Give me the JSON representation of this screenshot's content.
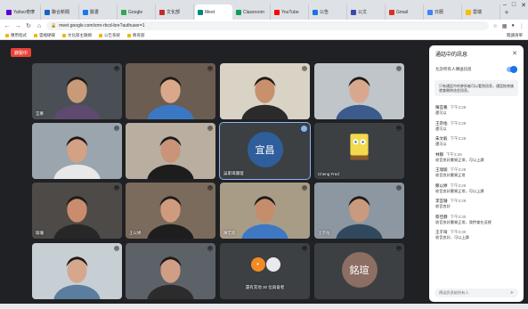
{
  "tabs": [
    {
      "label": "Yahoo奇摩",
      "color": "#6001d2"
    },
    {
      "label": "聯合新聞",
      "color": "#1565c0"
    },
    {
      "label": "臉書",
      "color": "#1877f2"
    },
    {
      "label": "Google",
      "color": "#34a853"
    },
    {
      "label": "文化部",
      "color": "#c62828"
    },
    {
      "label": "Meet",
      "color": "#00897b",
      "active": true
    },
    {
      "label": "Classroom",
      "color": "#0f9d58"
    },
    {
      "label": "YouTube",
      "color": "#ff0000"
    },
    {
      "label": "公告",
      "color": "#1a73e8"
    },
    {
      "label": "公文",
      "color": "#3949ab"
    },
    {
      "label": "Gmail",
      "color": "#d93025"
    },
    {
      "label": "日曆",
      "color": "#4285f4"
    },
    {
      "label": "雲端",
      "color": "#fbbc04"
    }
  ],
  "address": {
    "url": "meet.google.com/xmr-rbcd-bre?authuser=1"
  },
  "bookmarks": [
    "應用程式",
    "雲端硬碟",
    "文化部主題網",
    "公告系統",
    "教育部"
  ],
  "bookmarks_right": "閱讀清單",
  "live_badge": "錄製中",
  "tiles": [
    {
      "name": "宜蓁",
      "kind": "person",
      "bg": "#4a4f55",
      "skin": "#c99a7a",
      "shirt": "#5e4a6e"
    },
    {
      "name": "",
      "kind": "person",
      "bg": "#6b5d52",
      "skin": "#d9a88a",
      "shirt": "#3b78c4"
    },
    {
      "name": "",
      "kind": "person",
      "bg": "#d9d3c5",
      "skin": "#c8906c",
      "shirt": "#2b2b2b"
    },
    {
      "name": "",
      "kind": "person",
      "bg": "#bfc5c8",
      "skin": "#d8a88e",
      "shirt": "#3a5b8c"
    },
    {
      "name": "",
      "kind": "person",
      "bg": "#9aa5ad",
      "skin": "#d4a184",
      "shirt": "#e8e8e8"
    },
    {
      "name": "",
      "kind": "person",
      "bg": "#b9aea0",
      "skin": "#c99478",
      "shirt": "#1d1d1d"
    },
    {
      "name": "吳家瑋護理",
      "kind": "avatar",
      "initial": "宜昌",
      "avatar_color": "#2e5e9c"
    },
    {
      "name": "Cheng Fred",
      "kind": "sponge"
    },
    {
      "name": "瑜珊",
      "kind": "person",
      "bg": "#4e4a47",
      "skin": "#c98d6e",
      "shirt": "#272727"
    },
    {
      "name": "王以婷",
      "kind": "person",
      "bg": "#7a6b5c",
      "skin": "#cf9b7e",
      "shirt": "#1e1e1e"
    },
    {
      "name": "陳宏銘",
      "kind": "person",
      "bg": "#a89c86",
      "skin": "#c48e6c",
      "shirt": "#3f78c2"
    },
    {
      "name": "王宗佑",
      "kind": "person",
      "bg": "#8d97a1",
      "skin": "#c99a7e",
      "shirt": "#31495e"
    },
    {
      "name": "",
      "kind": "person",
      "bg": "#c8cfd4",
      "skin": "#d5a78c",
      "shirt": "#5b7e9e"
    },
    {
      "name": "",
      "kind": "person",
      "bg": "#5d6168",
      "skin": "#cf9e84",
      "shirt": "#2c2c2c"
    },
    {
      "name": "還有其他 30 位與會者",
      "kind": "more",
      "c1": "#f28b24",
      "c2": "#e8eaed"
    },
    {
      "name": "",
      "kind": "avatar",
      "initial": "銘瑄",
      "avatar_color": "#8d6e63"
    }
  ],
  "chat": {
    "title": "通話中的訊息",
    "toggle_label": "允許所有人傳送訊息",
    "notice": "只有通話中的參與者可以看到訊息，通話結束後就會刪除這些訊息。",
    "messages": [
      {
        "who": "陳宜蓁",
        "time": "下午3:28",
        "text": "還可以"
      },
      {
        "who": "王宗佑",
        "time": "下午3:28",
        "text": "還可以"
      },
      {
        "who": "朱文毅",
        "time": "下午3:28",
        "text": "還可以"
      },
      {
        "who": "林靜",
        "time": "下午3:28",
        "text": "收音良好畫質正常，可以上課"
      },
      {
        "who": "王瑞瑜",
        "time": "下午3:29",
        "text": "收音良好畫質正常"
      },
      {
        "who": "鄭以婷",
        "time": "下午3:29",
        "text": "收音良好畫質正常，可以上課"
      },
      {
        "who": "李宜珊",
        "time": "下午3:29",
        "text": "收音良好"
      },
      {
        "who": "蔡佳靜",
        "time": "下午3:30",
        "text": "收音良好畫質正常，我們會在這裡"
      },
      {
        "who": "王于琦",
        "time": "下午3:30",
        "text": "收音良好，可以上課"
      }
    ],
    "input_placeholder": "傳送訊息給所有人"
  }
}
